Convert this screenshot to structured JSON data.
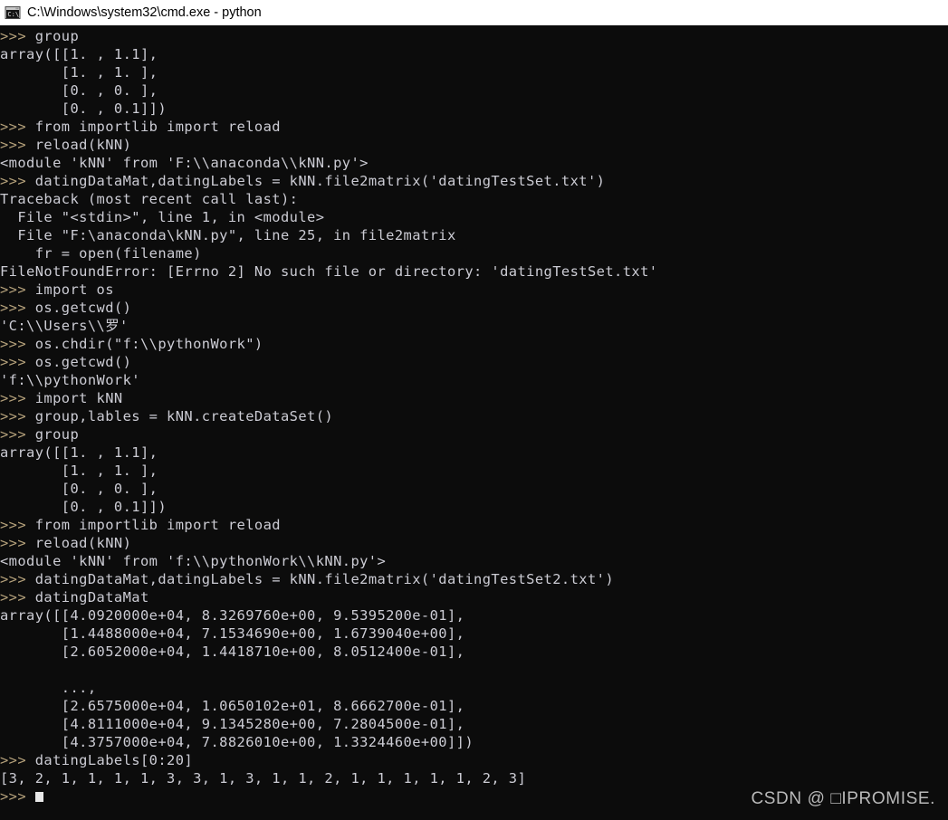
{
  "window": {
    "title": "C:\\Windows\\system32\\cmd.exe - python",
    "icon": "cmd-console-icon",
    "background_color": "#0c0c0c",
    "titlebar_color": "#ffffff",
    "text_color": "#ccccd4",
    "prompt_color": "#b4a07a"
  },
  "terminal": {
    "prompt": ">>> ",
    "cursor": "block-cursor",
    "lines": [
      {
        "type": "input",
        "prompt": ">>> ",
        "text": "group"
      },
      {
        "type": "output",
        "text": "array([[1. , 1.1],"
      },
      {
        "type": "output",
        "text": "       [1. , 1. ],"
      },
      {
        "type": "output",
        "text": "       [0. , 0. ],"
      },
      {
        "type": "output",
        "text": "       [0. , 0.1]])"
      },
      {
        "type": "input",
        "prompt": ">>> ",
        "text": "from importlib import reload"
      },
      {
        "type": "input",
        "prompt": ">>> ",
        "text": "reload(kNN)"
      },
      {
        "type": "output",
        "text": "<module 'kNN' from 'F:\\\\anaconda\\\\kNN.py'>"
      },
      {
        "type": "input",
        "prompt": ">>> ",
        "text": "datingDataMat,datingLabels = kNN.file2matrix('datingTestSet.txt')"
      },
      {
        "type": "output",
        "text": "Traceback (most recent call last):"
      },
      {
        "type": "output",
        "text": "  File \"<stdin>\", line 1, in <module>"
      },
      {
        "type": "output",
        "text": "  File \"F:\\anaconda\\kNN.py\", line 25, in file2matrix"
      },
      {
        "type": "output",
        "text": "    fr = open(filename)"
      },
      {
        "type": "output",
        "text": "FileNotFoundError: [Errno 2] No such file or directory: 'datingTestSet.txt'"
      },
      {
        "type": "input",
        "prompt": ">>> ",
        "text": "import os"
      },
      {
        "type": "input",
        "prompt": ">>> ",
        "text": "os.getcwd()"
      },
      {
        "type": "output",
        "text": "'C:\\\\Users\\\\罗'"
      },
      {
        "type": "input",
        "prompt": ">>> ",
        "text": "os.chdir(\"f:\\\\pythonWork\")"
      },
      {
        "type": "input",
        "prompt": ">>> ",
        "text": "os.getcwd()"
      },
      {
        "type": "output",
        "text": "'f:\\\\pythonWork'"
      },
      {
        "type": "input",
        "prompt": ">>> ",
        "text": "import kNN"
      },
      {
        "type": "input",
        "prompt": ">>> ",
        "text": "group,lables = kNN.createDataSet()"
      },
      {
        "type": "input",
        "prompt": ">>> ",
        "text": "group"
      },
      {
        "type": "output",
        "text": "array([[1. , 1.1],"
      },
      {
        "type": "output",
        "text": "       [1. , 1. ],"
      },
      {
        "type": "output",
        "text": "       [0. , 0. ],"
      },
      {
        "type": "output",
        "text": "       [0. , 0.1]])"
      },
      {
        "type": "input",
        "prompt": ">>> ",
        "text": "from importlib import reload"
      },
      {
        "type": "input",
        "prompt": ">>> ",
        "text": "reload(kNN)"
      },
      {
        "type": "output",
        "text": "<module 'kNN' from 'f:\\\\pythonWork\\\\kNN.py'>"
      },
      {
        "type": "input",
        "prompt": ">>> ",
        "text": "datingDataMat,datingLabels = kNN.file2matrix('datingTestSet2.txt')"
      },
      {
        "type": "input",
        "prompt": ">>> ",
        "text": "datingDataMat"
      },
      {
        "type": "output",
        "text": "array([[4.0920000e+04, 8.3269760e+00, 9.5395200e-01],"
      },
      {
        "type": "output",
        "text": "       [1.4488000e+04, 7.1534690e+00, 1.6739040e+00],"
      },
      {
        "type": "output",
        "text": "       [2.6052000e+04, 1.4418710e+00, 8.0512400e-01],"
      },
      {
        "type": "output",
        "text": ""
      },
      {
        "type": "output",
        "text": "       ...,"
      },
      {
        "type": "output",
        "text": "       [2.6575000e+04, 1.0650102e+01, 8.6662700e-01],"
      },
      {
        "type": "output",
        "text": "       [4.8111000e+04, 9.1345280e+00, 7.2804500e-01],"
      },
      {
        "type": "output",
        "text": "       [4.3757000e+04, 7.8826010e+00, 1.3324460e+00]])"
      },
      {
        "type": "input",
        "prompt": ">>> ",
        "text": "datingLabels[0:20]"
      },
      {
        "type": "output",
        "text": "[3, 2, 1, 1, 1, 1, 3, 3, 1, 3, 1, 1, 2, 1, 1, 1, 1, 1, 2, 3]"
      },
      {
        "type": "cursor",
        "prompt": ">>> ",
        "text": ""
      }
    ]
  },
  "watermark": {
    "text": "CSDN @ □IPROMISE."
  }
}
